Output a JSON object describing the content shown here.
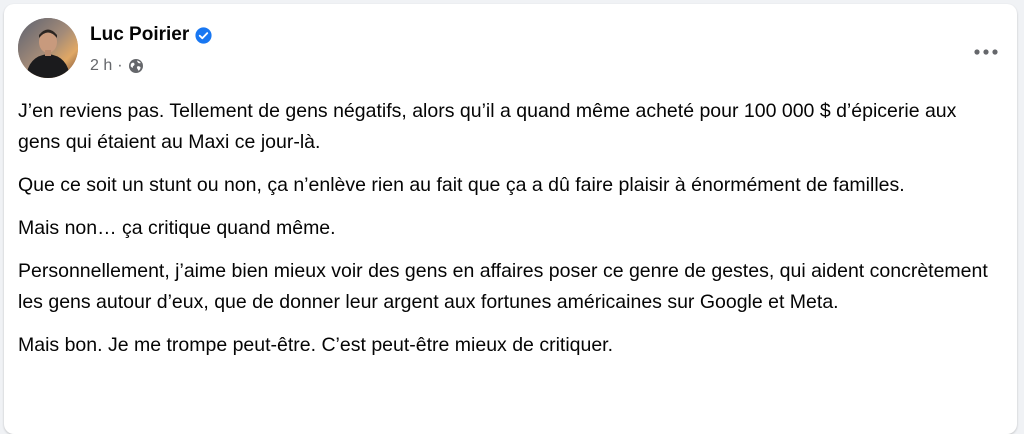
{
  "post": {
    "author": "Luc Poirier",
    "timestamp": "2 h",
    "separator": "·",
    "audience_icon": "globe-icon",
    "verified_icon": "verified-badge-icon",
    "more_icon": "more-options-icon",
    "paragraphs": [
      "J’en reviens pas. Tellement de gens négatifs, alors qu’il a quand même acheté pour 100 000 $ d’épicerie aux gens qui étaient au Maxi ce jour-là.",
      "Que ce soit un stunt ou non, ça n’enlève rien au fait que ça a dû faire plaisir à énormément de familles.",
      "Mais non… ça critique quand même.",
      "Personnellement, j’aime bien mieux voir des gens en affaires poser ce genre de gestes, qui aident concrètement les gens autour d’eux, que de donner leur argent aux fortunes américaines sur Google et Meta.",
      "Mais bon. Je me trompe peut-être. C’est peut-être mieux de critiquer."
    ]
  },
  "colors": {
    "background": "#f0f2f5",
    "card": "#ffffff",
    "text": "#050505",
    "secondary_text": "#65676b",
    "verified_blue": "#1877f2"
  }
}
